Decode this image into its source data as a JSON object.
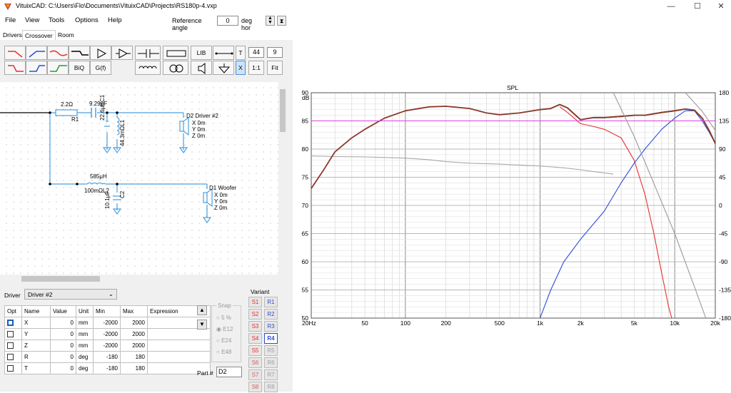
{
  "window": {
    "title": "VituixCAD: C:\\Users\\Flo\\Documents\\VituixCAD\\Projects\\RS180p-4.vxp",
    "minimize": "—",
    "maximize": "☐",
    "close": "✕"
  },
  "menu": [
    "File",
    "View",
    "Tools",
    "Options",
    "Help"
  ],
  "reference": {
    "label": "Reference angle",
    "value": "0",
    "unit": "deg hor"
  },
  "tabs": [
    "Drivers",
    "Crossover",
    "Room"
  ],
  "toolbar": {
    "lib": "LIB",
    "t": "T",
    "t_value1": "44",
    "t_value2": "9",
    "biq": "BiQ",
    "gf": "G(f)",
    "x": "X",
    "one_to_one": "1:1",
    "fit": "Fit"
  },
  "schematic": {
    "r1": {
      "value": "2.2Ω",
      "name": "R1"
    },
    "c1": {
      "value": "9.29μF",
      "name": "C1"
    },
    "l1": {
      "value": "22.6μH",
      "resistance": "44.3mΩ",
      "name": "L1"
    },
    "d2": {
      "name": "D2 Driver #2",
      "x": "X 0m",
      "y": "Y 0m",
      "z": "Z 0m"
    },
    "l2": {
      "value": "585μH",
      "resistance": "100mΩ",
      "name": "L2"
    },
    "c2": {
      "value": "10.1μF",
      "name": "C2"
    },
    "d1": {
      "name": "D1 Woofer",
      "x": "X 0m",
      "y": "Y 0m",
      "z": "Z 0m"
    }
  },
  "driver_select": {
    "label": "Driver",
    "value": "Driver #2"
  },
  "params": {
    "headers": [
      "Opt",
      "Name",
      "Value",
      "Unit",
      "Min",
      "Max",
      "Expression"
    ],
    "rows": [
      {
        "name": "X",
        "value": "0",
        "unit": "mm",
        "min": "-2000",
        "max": "2000",
        "expr": ""
      },
      {
        "name": "Y",
        "value": "0",
        "unit": "mm",
        "min": "-2000",
        "max": "2000",
        "expr": ""
      },
      {
        "name": "Z",
        "value": "0",
        "unit": "mm",
        "min": "-2000",
        "max": "2000",
        "expr": ""
      },
      {
        "name": "R",
        "value": "0",
        "unit": "deg",
        "min": "-180",
        "max": "180",
        "expr": ""
      },
      {
        "name": "T",
        "value": "0",
        "unit": "deg",
        "min": "-180",
        "max": "180",
        "expr": ""
      }
    ]
  },
  "snap": {
    "label": "Snap",
    "options": [
      "5 %",
      "E12",
      "E24",
      "E48"
    ],
    "selected": "E12"
  },
  "part": {
    "label": "Part #",
    "value": "D2"
  },
  "variant": {
    "label": "Variant",
    "s": [
      "S1",
      "S2",
      "S3",
      "S4",
      "S5",
      "S6",
      "S7",
      "S8"
    ],
    "r": [
      "R1",
      "R2",
      "R3",
      "R4",
      "R5",
      "R6",
      "R7",
      "R8"
    ],
    "active_r": "R4"
  },
  "colors": {
    "red": "#e53030",
    "blue": "#2f4bd8",
    "brown": "#8b3a2a",
    "magenta": "#e040e0",
    "gray": "#a0a0a0",
    "green_dark": "#3a5a3a"
  },
  "chart_data": {
    "type": "line",
    "title": "SPL",
    "ylabel": "dB",
    "xscale": "log",
    "xlim": [
      20,
      20000
    ],
    "ylim": [
      50,
      90
    ],
    "y2lim": [
      -180,
      180
    ],
    "xticks": [
      "20Hz",
      "50",
      "100",
      "200",
      "500",
      "1k",
      "2k",
      "5k",
      "10k",
      "20k"
    ],
    "xtick_values": [
      20,
      50,
      100,
      200,
      500,
      1000,
      2000,
      5000,
      10000,
      20000
    ],
    "yticks": [
      50,
      55,
      60,
      65,
      70,
      75,
      80,
      85,
      90
    ],
    "y2ticks": [
      -180,
      -135,
      -90,
      -45,
      0,
      45,
      90,
      135,
      180
    ],
    "series": [
      {
        "color": "#a8a8a8",
        "axis": "y2",
        "points": [
          [
            20,
            79
          ],
          [
            30,
            78
          ],
          [
            50,
            77.5
          ],
          [
            70,
            76.5
          ],
          [
            100,
            75.5
          ],
          [
            150,
            73
          ],
          [
            200,
            70
          ],
          [
            300,
            67.5
          ],
          [
            500,
            66
          ],
          [
            700,
            64.5
          ],
          [
            1000,
            63
          ],
          [
            1500,
            60
          ],
          [
            2000,
            57
          ],
          [
            2500,
            54
          ],
          [
            3000,
            52
          ],
          [
            3500,
            50
          ]
        ]
      },
      {
        "color": "#e53030",
        "points": [
          [
            1400,
            87.5
          ],
          [
            1600,
            86.5
          ],
          [
            2000,
            84.5
          ],
          [
            2500,
            84
          ],
          [
            3000,
            83.5
          ],
          [
            4000,
            82
          ],
          [
            5000,
            78
          ],
          [
            6000,
            72
          ],
          [
            7000,
            65
          ],
          [
            8000,
            58
          ],
          [
            9000,
            52
          ],
          [
            9500,
            50
          ]
        ]
      },
      {
        "color": "#2f4bd8",
        "points": [
          [
            1000,
            50
          ],
          [
            1200,
            55
          ],
          [
            1500,
            60
          ],
          [
            2000,
            64
          ],
          [
            3000,
            69
          ],
          [
            4000,
            74
          ],
          [
            5000,
            77.5
          ],
          [
            6000,
            80
          ],
          [
            8000,
            83.5
          ],
          [
            10000,
            85.5
          ],
          [
            12000,
            86.8
          ],
          [
            14000,
            86.8
          ],
          [
            16000,
            85
          ],
          [
            18000,
            83
          ],
          [
            20000,
            81
          ]
        ]
      },
      {
        "color": "#3a5a3a",
        "points": [
          [
            1000,
            87
          ],
          [
            1200,
            87.2
          ],
          [
            1400,
            87.9
          ],
          [
            1600,
            87.3
          ],
          [
            2000,
            85.2
          ],
          [
            2500,
            85.6
          ],
          [
            3000,
            85.6
          ],
          [
            4000,
            85.8
          ],
          [
            5000,
            86
          ],
          [
            6000,
            86
          ],
          [
            8000,
            86.5
          ],
          [
            10000,
            86.8
          ],
          [
            12000,
            87.1
          ],
          [
            14000,
            86.9
          ],
          [
            16000,
            85.5
          ],
          [
            18000,
            83.3
          ],
          [
            20000,
            81
          ]
        ]
      },
      {
        "color": "#8b3a2a",
        "points": [
          [
            20,
            73
          ],
          [
            25,
            76.5
          ],
          [
            30,
            79.5
          ],
          [
            40,
            82
          ],
          [
            50,
            83.5
          ],
          [
            70,
            85.5
          ],
          [
            100,
            86.8
          ],
          [
            150,
            87.5
          ],
          [
            200,
            87.6
          ],
          [
            300,
            87.2
          ],
          [
            400,
            86.4
          ],
          [
            500,
            86.1
          ],
          [
            700,
            86.4
          ],
          [
            1000,
            87
          ],
          [
            1200,
            87.2
          ],
          [
            1400,
            87.9
          ],
          [
            1600,
            87.3
          ],
          [
            2000,
            85.2
          ],
          [
            2500,
            85.6
          ],
          [
            3000,
            85.6
          ],
          [
            4000,
            85.8
          ],
          [
            5000,
            86
          ],
          [
            6000,
            86
          ],
          [
            8000,
            86.5
          ],
          [
            10000,
            86.8
          ],
          [
            12000,
            87.1
          ],
          [
            14000,
            86.9
          ],
          [
            16000,
            85.5
          ],
          [
            18000,
            83.3
          ],
          [
            20000,
            81
          ]
        ]
      },
      {
        "color": "#e040e0",
        "points": [
          [
            20,
            85
          ],
          [
            20000,
            85
          ]
        ]
      },
      {
        "color": "#9a9a9a",
        "axis": "y2",
        "points": [
          [
            3500,
            180
          ],
          [
            5000,
            110
          ],
          [
            7000,
            35
          ],
          [
            10000,
            -45
          ],
          [
            14000,
            -130
          ],
          [
            17000,
            -180
          ]
        ]
      },
      {
        "color": "#9a9a9a",
        "axis": "y2",
        "points": [
          [
            12000,
            180
          ],
          [
            16000,
            150
          ],
          [
            20000,
            120
          ]
        ]
      }
    ]
  }
}
